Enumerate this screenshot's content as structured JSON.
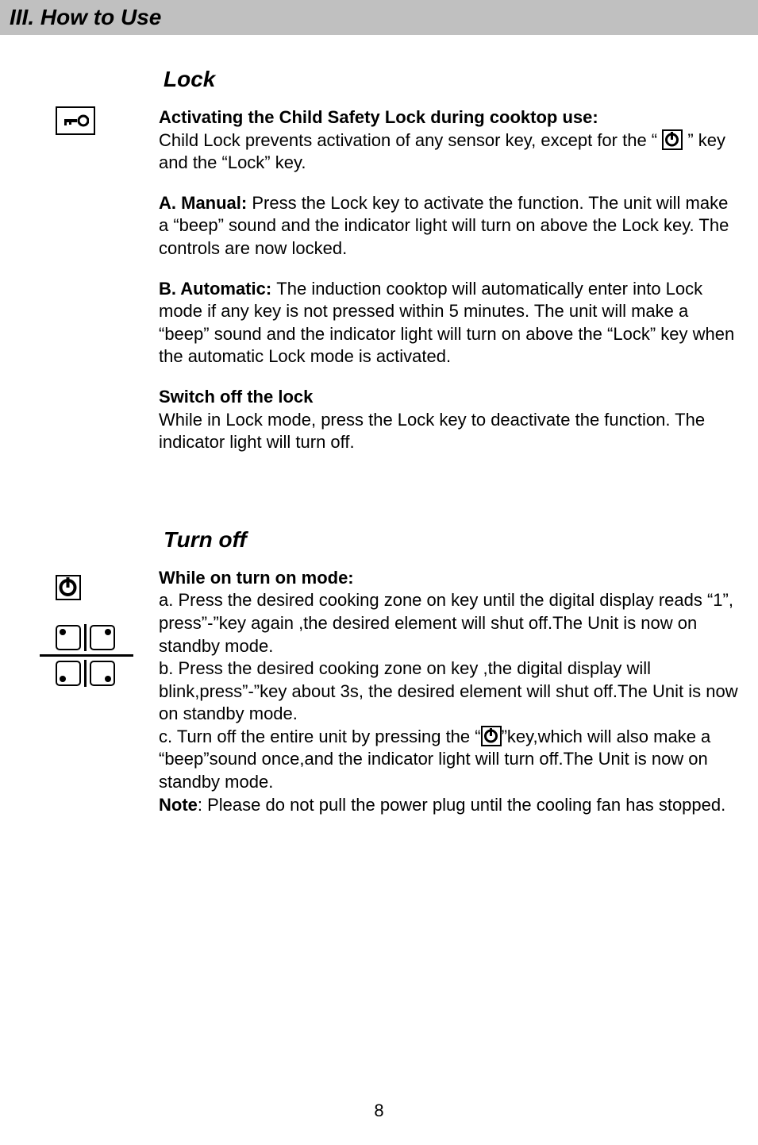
{
  "header": "III.  How to Use",
  "lock": {
    "title": "Lock",
    "p1_bold": "Activating the Child Safety Lock during cooktop use:",
    "p1_a": "Child Lock prevents activation of any sensor key, except for the “ ",
    "p1_b": " ” key and the “Lock” key.",
    "p2_label": "A. Manual: ",
    "p2_text": "Press the Lock key to activate the function. The unit will make a “beep” sound and the indicator light will turn on above the Lock key. The controls are now locked.",
    "p3_label": "B. Automatic: ",
    "p3_text": "The induction cooktop will automatically enter into Lock mode if any key is not pressed within 5 minutes. The unit will make a “beep” sound and the indicator light will turn on above the “Lock” key when the automatic Lock mode is activated.",
    "p4_bold": "Switch off the lock",
    "p4_text": "While in Lock mode, press the Lock key to deactivate the function. The indicator light will turn off."
  },
  "turnoff": {
    "title": "Turn off",
    "p1_bold": "While on turn on mode:",
    "p1_a": "a. Press the desired cooking zone on key until the digital display reads “1”, press”-”key again ,the desired element will shut off.The Unit is now on standby mode.",
    "p1_b": "b. Press the desired cooking zone on key ,the digital display will blink,press”-”key about 3s, the desired element will shut off.The Unit is now on standby mode.",
    "p1_c1": "c. Turn off the entire unit by pressing the “",
    "p1_c2": "”key,which will also make a “beep”sound once,and the indicator light will turn off.The Unit is now on standby mode.",
    "note_label": "Note",
    "note_text": ": Please do not pull the power plug until the cooling fan has stopped."
  },
  "page": "8"
}
